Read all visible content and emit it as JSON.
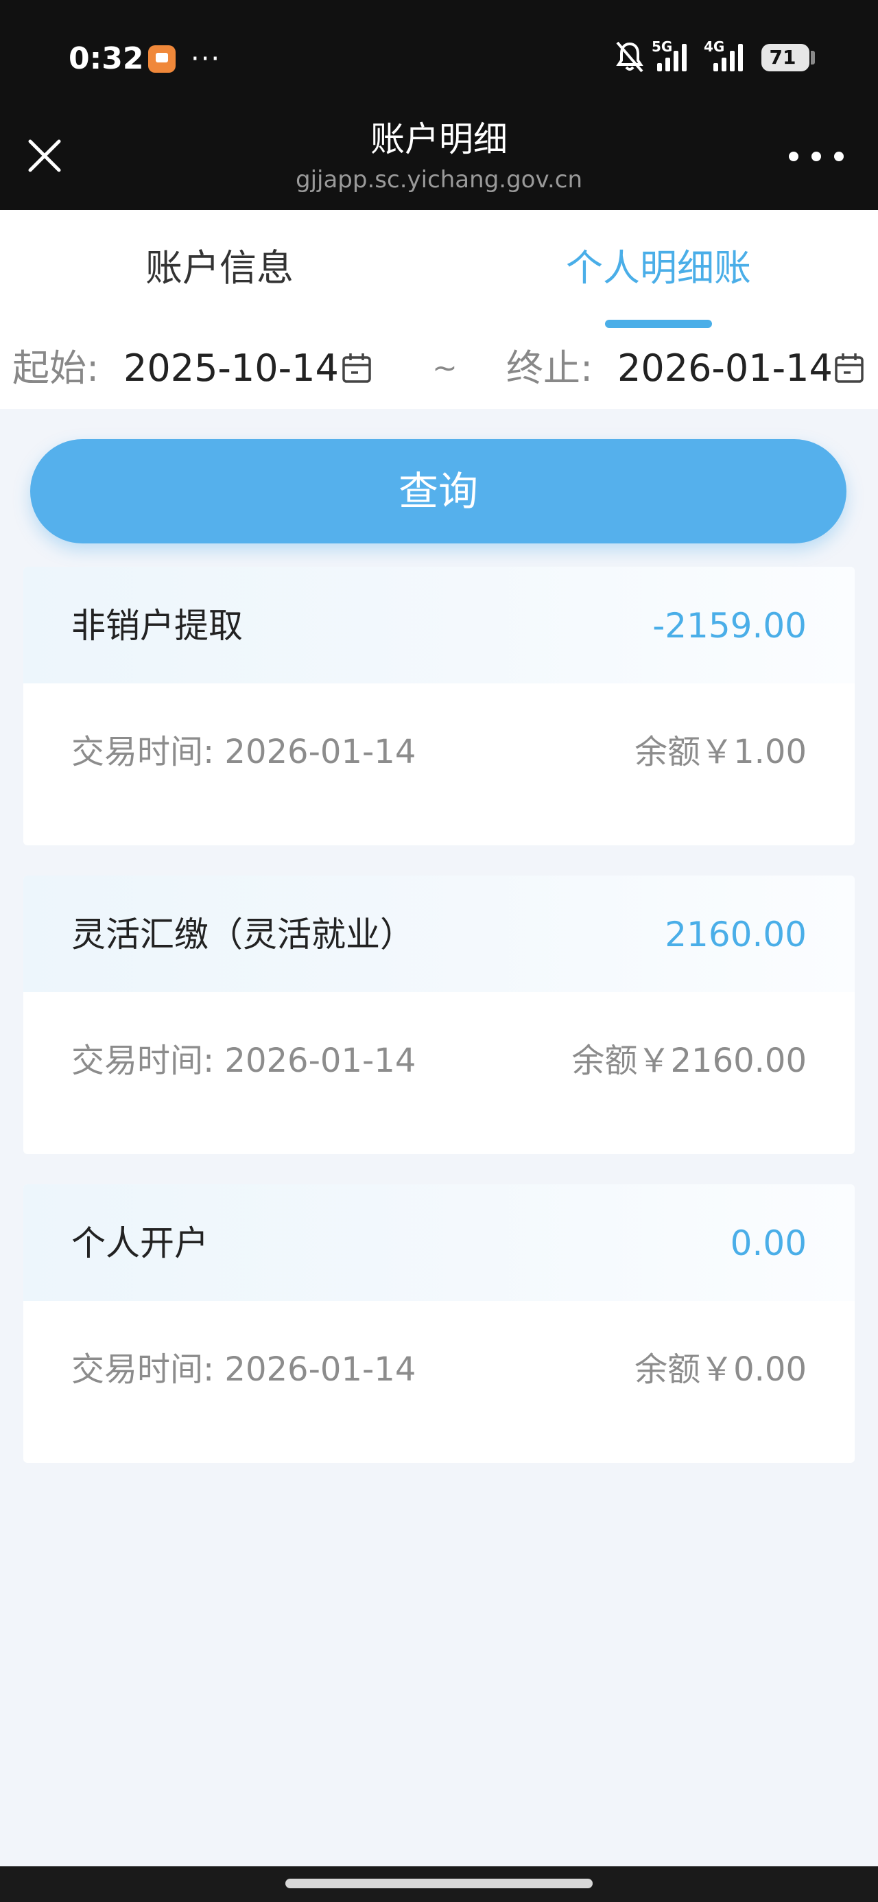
{
  "status_bar": {
    "time": "0:32",
    "more": "···",
    "net1": "5G",
    "net2": "4G",
    "battery": "71"
  },
  "nav": {
    "title": "账户明细",
    "url": "gjjapp.sc.yichang.gov.cn"
  },
  "tabs": [
    {
      "label": "账户信息",
      "active": false
    },
    {
      "label": "个人明细账",
      "active": true
    }
  ],
  "date_filter": {
    "start_label": "起始:",
    "start_value": "2025-10-14",
    "separator": "~",
    "end_label": "终止:",
    "end_value": "2026-01-14"
  },
  "query_button": "查询",
  "records": [
    {
      "type": "非销户提取",
      "amount": "-2159.00",
      "time": "交易时间: 2026-01-14",
      "balance": "余额￥1.00"
    },
    {
      "type": "灵活汇缴（灵活就业）",
      "amount": "2160.00",
      "time": "交易时间: 2026-01-14",
      "balance": "余额￥2160.00"
    },
    {
      "type": "个人开户",
      "amount": "0.00",
      "time": "交易时间: 2026-01-14",
      "balance": "余额￥0.00"
    }
  ],
  "colors": {
    "accent": "#4aaee8",
    "button": "#55b0ec",
    "background": "#f2f5fa",
    "topbar": "#111111"
  }
}
